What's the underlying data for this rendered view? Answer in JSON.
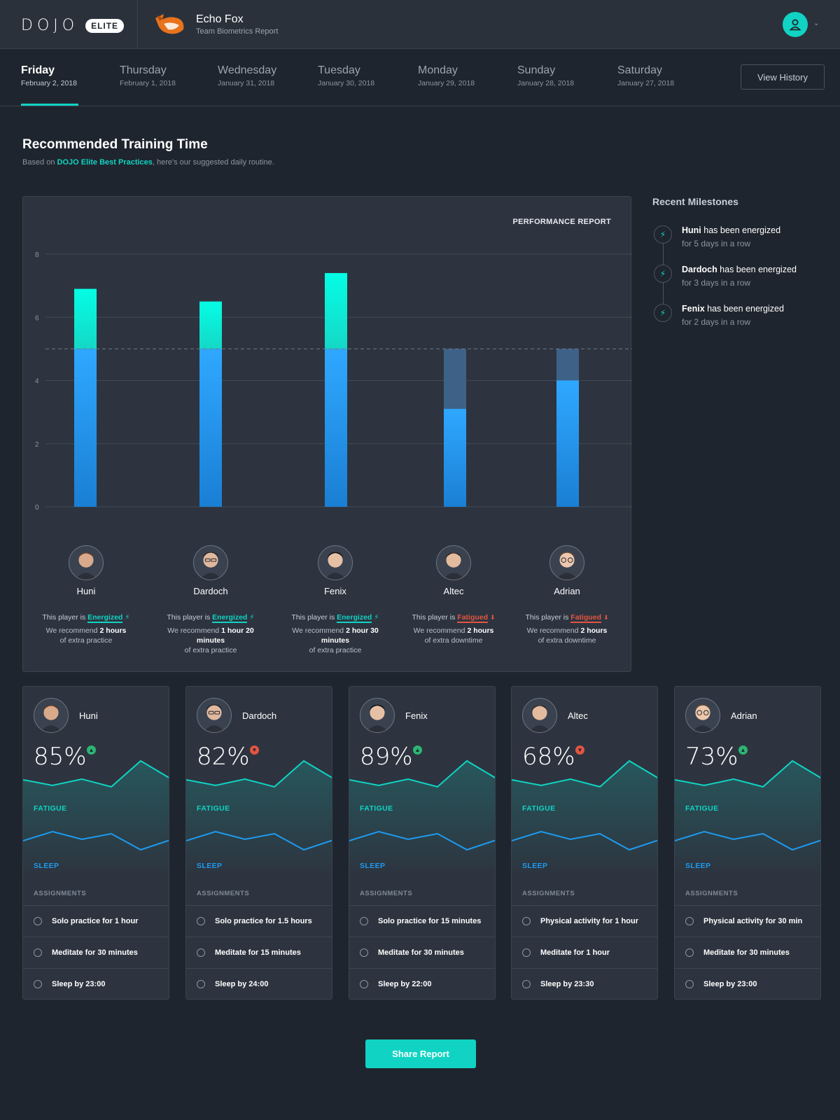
{
  "header": {
    "logo_word": "DOJO",
    "logo_badge": "ELITE",
    "team_name": "Echo Fox",
    "team_sub": "Team Biometrics Report"
  },
  "days": [
    {
      "name": "Friday",
      "date": "February 2, 2018"
    },
    {
      "name": "Thursday",
      "date": "February 1, 2018"
    },
    {
      "name": "Wednesday",
      "date": "January 31, 2018"
    },
    {
      "name": "Tuesday",
      "date": "January 30, 2018"
    },
    {
      "name": "Monday",
      "date": "January 29, 2018"
    },
    {
      "name": "Sunday",
      "date": "January 28, 2018"
    },
    {
      "name": "Saturday",
      "date": "January 27, 2018"
    }
  ],
  "view_history_label": "View History",
  "section": {
    "title": "Recommended Training Time",
    "sub_prefix": "Based on ",
    "sub_link": "DOJO Elite Best Practices",
    "sub_suffix": ", here's our suggested daily routine."
  },
  "chart_data": {
    "type": "bar",
    "title": "PERFORMANCE REPORT",
    "categories": [
      "Huni",
      "Dardoch",
      "Fenix",
      "Altec",
      "Adrian"
    ],
    "series": [
      {
        "values": [
          5,
          5,
          5,
          3.1,
          4
        ]
      },
      {
        "values": [
          1.9,
          1.5,
          2.4,
          1.9,
          1
        ]
      }
    ],
    "threshold": 5,
    "ylim": [
      0,
      8
    ],
    "yticks": [
      "0",
      "2",
      "4",
      "6",
      "8"
    ],
    "grid": true,
    "colors": {
      "base": "#2196f3",
      "extra": "#05f0dc",
      "downtime": "#3e6188"
    }
  },
  "players": [
    {
      "name": "Huni",
      "status_prefix": "This player is ",
      "state": "Energized",
      "state_class": "en",
      "rec_prefix": "We recommend ",
      "rec_bold": "2 hours",
      "rec_suffix": "of extra practice"
    },
    {
      "name": "Dardoch",
      "status_prefix": "This player is ",
      "state": "Energized",
      "state_class": "en",
      "rec_prefix": "We recommend ",
      "rec_bold": "1 hour 20 minutes",
      "rec_suffix": "of extra practice"
    },
    {
      "name": "Fenix",
      "status_prefix": "This player is ",
      "state": "Energized",
      "state_class": "en",
      "rec_prefix": "We recommend ",
      "rec_bold": "2 hour 30 minutes",
      "rec_suffix": "of extra practice"
    },
    {
      "name": "Altec",
      "status_prefix": "This player is ",
      "state": "Fatigued",
      "state_class": "fa",
      "rec_prefix": "We recommend ",
      "rec_bold": "2 hours",
      "rec_suffix": "of extra downtime"
    },
    {
      "name": "Adrian",
      "status_prefix": "This player is ",
      "state": "Fatigued",
      "state_class": "fa",
      "rec_prefix": "We recommend ",
      "rec_bold": "2 hours",
      "rec_suffix": "of extra downtime"
    }
  ],
  "milestones": {
    "title": "Recent Milestones",
    "items": [
      {
        "name": "Huni",
        "text": " has been energized",
        "sub": "for 5 days in a row"
      },
      {
        "name": "Dardoch",
        "text": " has been energized",
        "sub": "for 3 days in a row"
      },
      {
        "name": "Fenix",
        "text": " has been energized",
        "sub": "for 2 days in a row"
      }
    ]
  },
  "cards": [
    {
      "name": "Huni",
      "pct": "85%",
      "trend": "up",
      "fatigue": "FATIGUE",
      "sleep": "SLEEP",
      "assign": "ASSIGNMENTS",
      "tasks": [
        "Solo practice for 1 hour",
        "Meditate for 30 minutes",
        "Sleep by 23:00"
      ]
    },
    {
      "name": "Dardoch",
      "pct": "82%",
      "trend": "down",
      "fatigue": "FATIGUE",
      "sleep": "SLEEP",
      "assign": "ASSIGNMENTS",
      "tasks": [
        "Solo practice for 1.5 hours",
        "Meditate for 15 minutes",
        "Sleep by 24:00"
      ]
    },
    {
      "name": "Fenix",
      "pct": "89%",
      "trend": "up",
      "fatigue": "FATIGUE",
      "sleep": "SLEEP",
      "assign": "ASSIGNMENTS",
      "tasks": [
        "Solo practice for 15 minutes",
        "Meditate for 30 minutes",
        "Sleep by 22:00"
      ]
    },
    {
      "name": "Altec",
      "pct": "68%",
      "trend": "down",
      "fatigue": "FATIGUE",
      "sleep": "SLEEP",
      "assign": "ASSIGNMENTS",
      "tasks": [
        "Physical activity for 1 hour",
        "Meditate for 1 hour",
        "Sleep by 23:30"
      ]
    },
    {
      "name": "Adrian",
      "pct": "73%",
      "trend": "up",
      "fatigue": "FATIGUE",
      "sleep": "SLEEP",
      "assign": "ASSIGNMENTS",
      "tasks": [
        "Physical activity for 30 min",
        "Meditate for 30 minutes",
        "Sleep by 23:00"
      ]
    }
  ],
  "share_label": "Share Report",
  "accent_color": "#10d3c3"
}
